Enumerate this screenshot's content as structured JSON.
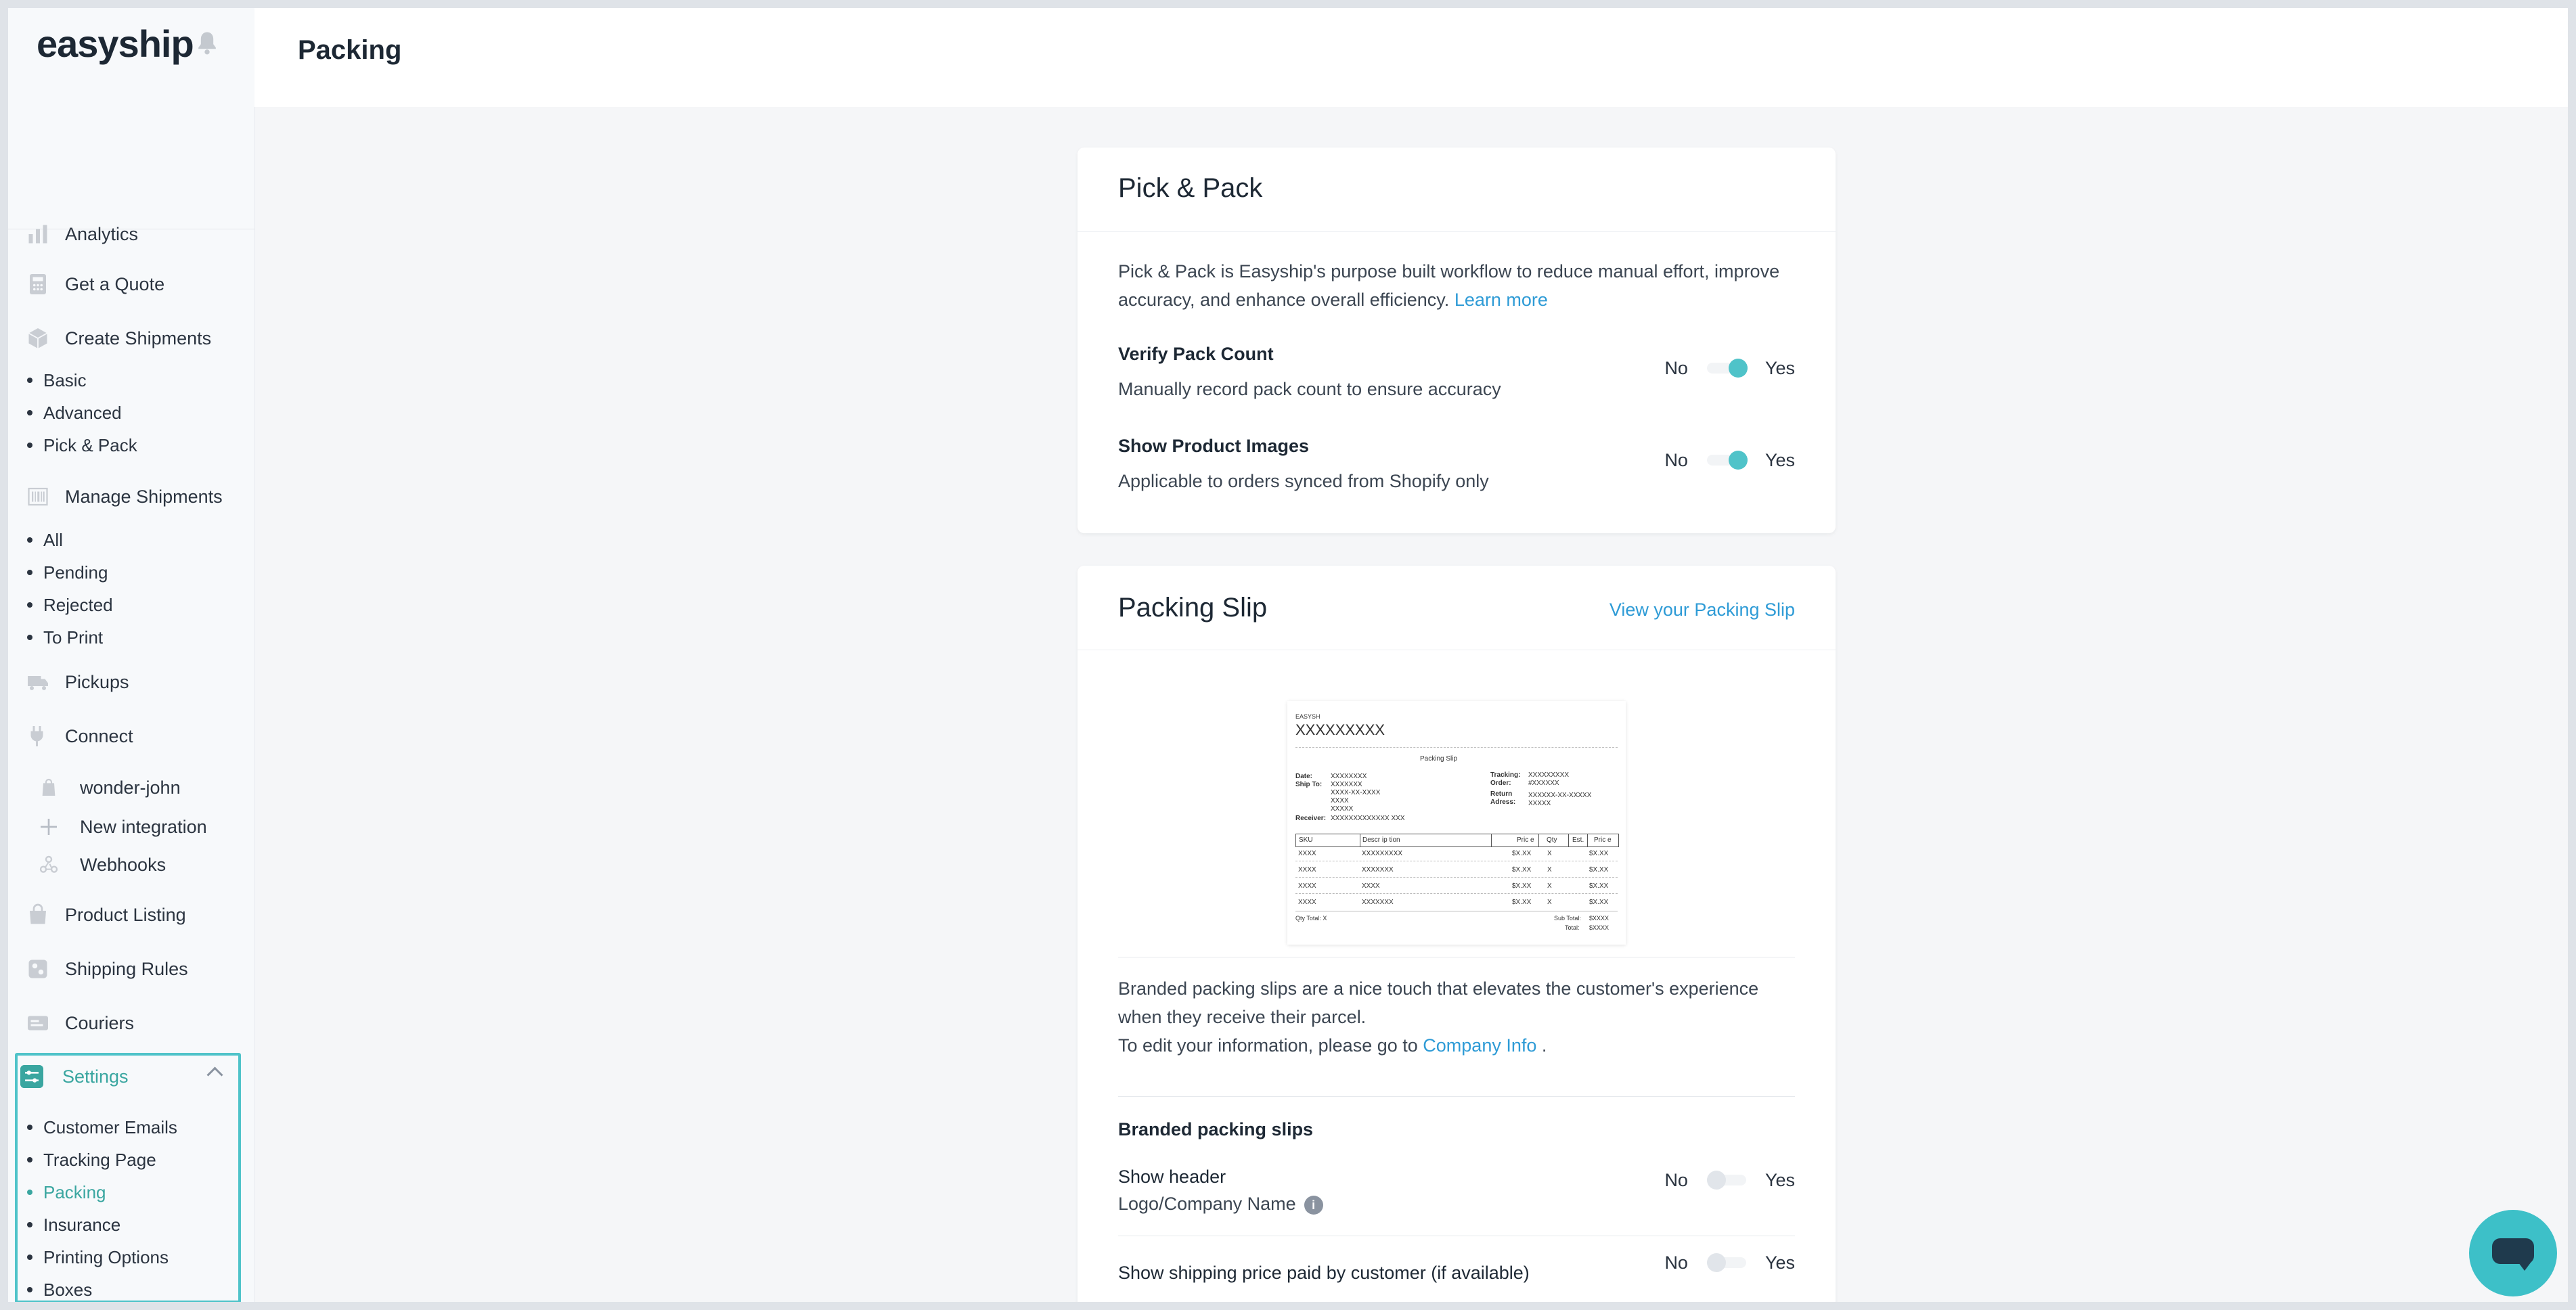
{
  "app": {
    "brand": "easyship",
    "accent_color": "#4fc3c9",
    "link_color": "#2e9bd6"
  },
  "header": {
    "title": "Packing"
  },
  "sidebar": {
    "items": [
      {
        "label": "Analytics",
        "icon": "chart-icon"
      },
      {
        "label": "Get a Quote",
        "icon": "calculator-icon"
      },
      {
        "label": "Create Shipments",
        "icon": "box-icon"
      },
      {
        "label": "Manage Shipments",
        "icon": "barcode-icon"
      },
      {
        "label": "Pickups",
        "icon": "truck-icon"
      },
      {
        "label": "Connect",
        "icon": "plug-icon"
      },
      {
        "label": "Product Listing",
        "icon": "bag-icon"
      },
      {
        "label": "Shipping Rules",
        "icon": "rules-icon"
      },
      {
        "label": "Couriers",
        "icon": "courier-icon"
      },
      {
        "label": "Settings",
        "icon": "settings-icon"
      }
    ],
    "create_sub": [
      "Basic",
      "Advanced",
      "Pick & Pack"
    ],
    "manage_sub": [
      "All",
      "Pending",
      "Rejected",
      "To Print"
    ],
    "connect_sub": [
      {
        "label": "wonder-john",
        "icon": "store-icon"
      },
      {
        "label": "New integration",
        "icon": "plus-icon"
      },
      {
        "label": "Webhooks",
        "icon": "webhook-icon"
      }
    ],
    "settings_sub": [
      "Customer Emails",
      "Tracking Page",
      "Packing",
      "Insurance",
      "Printing Options",
      "Boxes"
    ],
    "active_sub": "Packing"
  },
  "pick_pack": {
    "title": "Pick & Pack",
    "description": "Pick & Pack is Easyship's purpose built workflow to reduce manual effort, improve accuracy, and enhance overall efficiency.",
    "learn_more": "Learn more",
    "options": [
      {
        "title": "Verify Pack Count",
        "subtitle": "Manually record pack count to ensure accuracy",
        "value": "Yes"
      },
      {
        "title": "Show Product Images",
        "subtitle": "Applicable to orders synced from Shopify only",
        "value": "Yes"
      }
    ]
  },
  "packing_slip": {
    "title": "Packing Slip",
    "view_link": "View your Packing Slip",
    "preview": {
      "brand": "EASYSH",
      "company": "XXXXXXXXX",
      "heading": "Packing Slip",
      "date_label": "Date:",
      "date_value": "XXXXXXXX",
      "ship_to_label": "Ship To:",
      "ship_to_lines": [
        "XXXXXXX",
        "XXXX-XX-XXXX",
        "XXXX",
        "XXXXX"
      ],
      "receiver_label": "Receiver:",
      "receiver_value": "XXXXXXXXXXXXX XXX",
      "tracking_label": "Tracking:",
      "tracking_value": "XXXXXXXXX",
      "order_label": "Order:",
      "order_value": "#XXXXXX",
      "return_label": "Return",
      "address_label": "Adress:",
      "return_lines": [
        "XXXXXX-XX-XXXXX",
        "XXXXX"
      ],
      "columns": [
        "SKU",
        "Descr ip tion",
        "Pric e",
        "Qty",
        "Est.",
        "Pric e"
      ],
      "rows": [
        [
          "XXXX",
          "XXXXXXXXX",
          "$X.XX",
          "X",
          "$X.XX"
        ],
        [
          "XXXX",
          "XXXXXXX",
          "$X.XX",
          "X",
          "$X.XX"
        ],
        [
          "XXXX",
          "XXXX",
          "$X.XX",
          "X",
          "$X.XX"
        ],
        [
          "XXXX",
          "XXXXXXX",
          "$X.XX",
          "X",
          "$X.XX"
        ]
      ],
      "qty_total": "Qty Total: X",
      "sub_total_label": "Sub Total:",
      "sub_total_value": "$XXXX",
      "total_label": "Total:",
      "total_value": "$XXXX"
    },
    "description": "Branded packing slips are a nice touch that elevates the customer's experience when they receive their parcel.",
    "edit_info_prefix": "To edit your information, please go to",
    "company_info_link": "Company Info",
    "edit_info_suffix": ".",
    "branded_title": "Branded packing slips",
    "show_header": {
      "title": "Show header",
      "subtitle": "Logo/Company Name",
      "value": "No"
    },
    "show_price": {
      "title": "Show shipping price paid by customer (if available)",
      "value": "No"
    }
  },
  "toggle_labels": {
    "no": "No",
    "yes": "Yes"
  }
}
